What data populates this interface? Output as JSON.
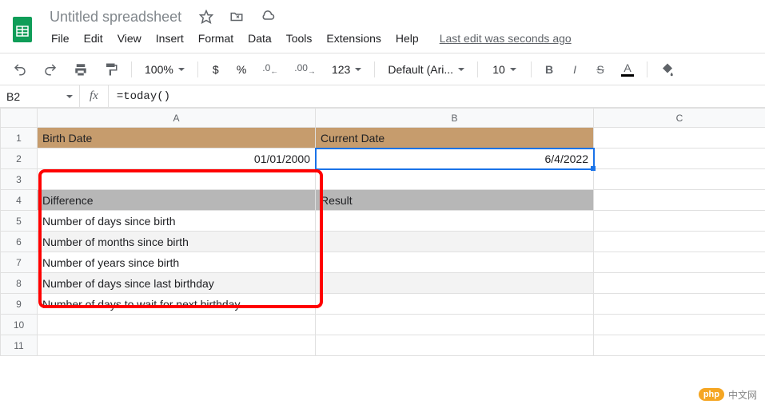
{
  "doc": {
    "title": "Untitled spreadsheet",
    "last_edit": "Last edit was seconds ago"
  },
  "menu": {
    "file": "File",
    "edit": "Edit",
    "view": "View",
    "insert": "Insert",
    "format": "Format",
    "data": "Data",
    "tools": "Tools",
    "extensions": "Extensions",
    "help": "Help"
  },
  "toolbar": {
    "zoom": "100%",
    "currency": "$",
    "percent": "%",
    "dec_dec": ".0",
    "inc_dec": ".00",
    "fmt123": "123",
    "font": "Default (Ari...",
    "size": "10",
    "bold": "B",
    "italic": "I",
    "strike": "S",
    "textcolor": "A"
  },
  "formula": {
    "cell_ref": "B2",
    "fx": "fx",
    "content": "=today()"
  },
  "grid": {
    "cols": [
      "A",
      "B",
      "C"
    ],
    "rows": [
      "1",
      "2",
      "3",
      "4",
      "5",
      "6",
      "7",
      "8",
      "9",
      "10",
      "11"
    ],
    "A1": "Birth Date",
    "B1": "Current Date",
    "A2": "01/01/2000",
    "B2": "6/4/2022",
    "A4": "Difference",
    "B4": "Result",
    "A5": "Number of days since birth",
    "A6": "Number of months since birth",
    "A7": "Number of years since birth",
    "A8": "Number of days since last birthday",
    "A9": "Number of days to wait for next birthday"
  },
  "watermark": {
    "badge1": "php",
    "text": "中文网"
  }
}
